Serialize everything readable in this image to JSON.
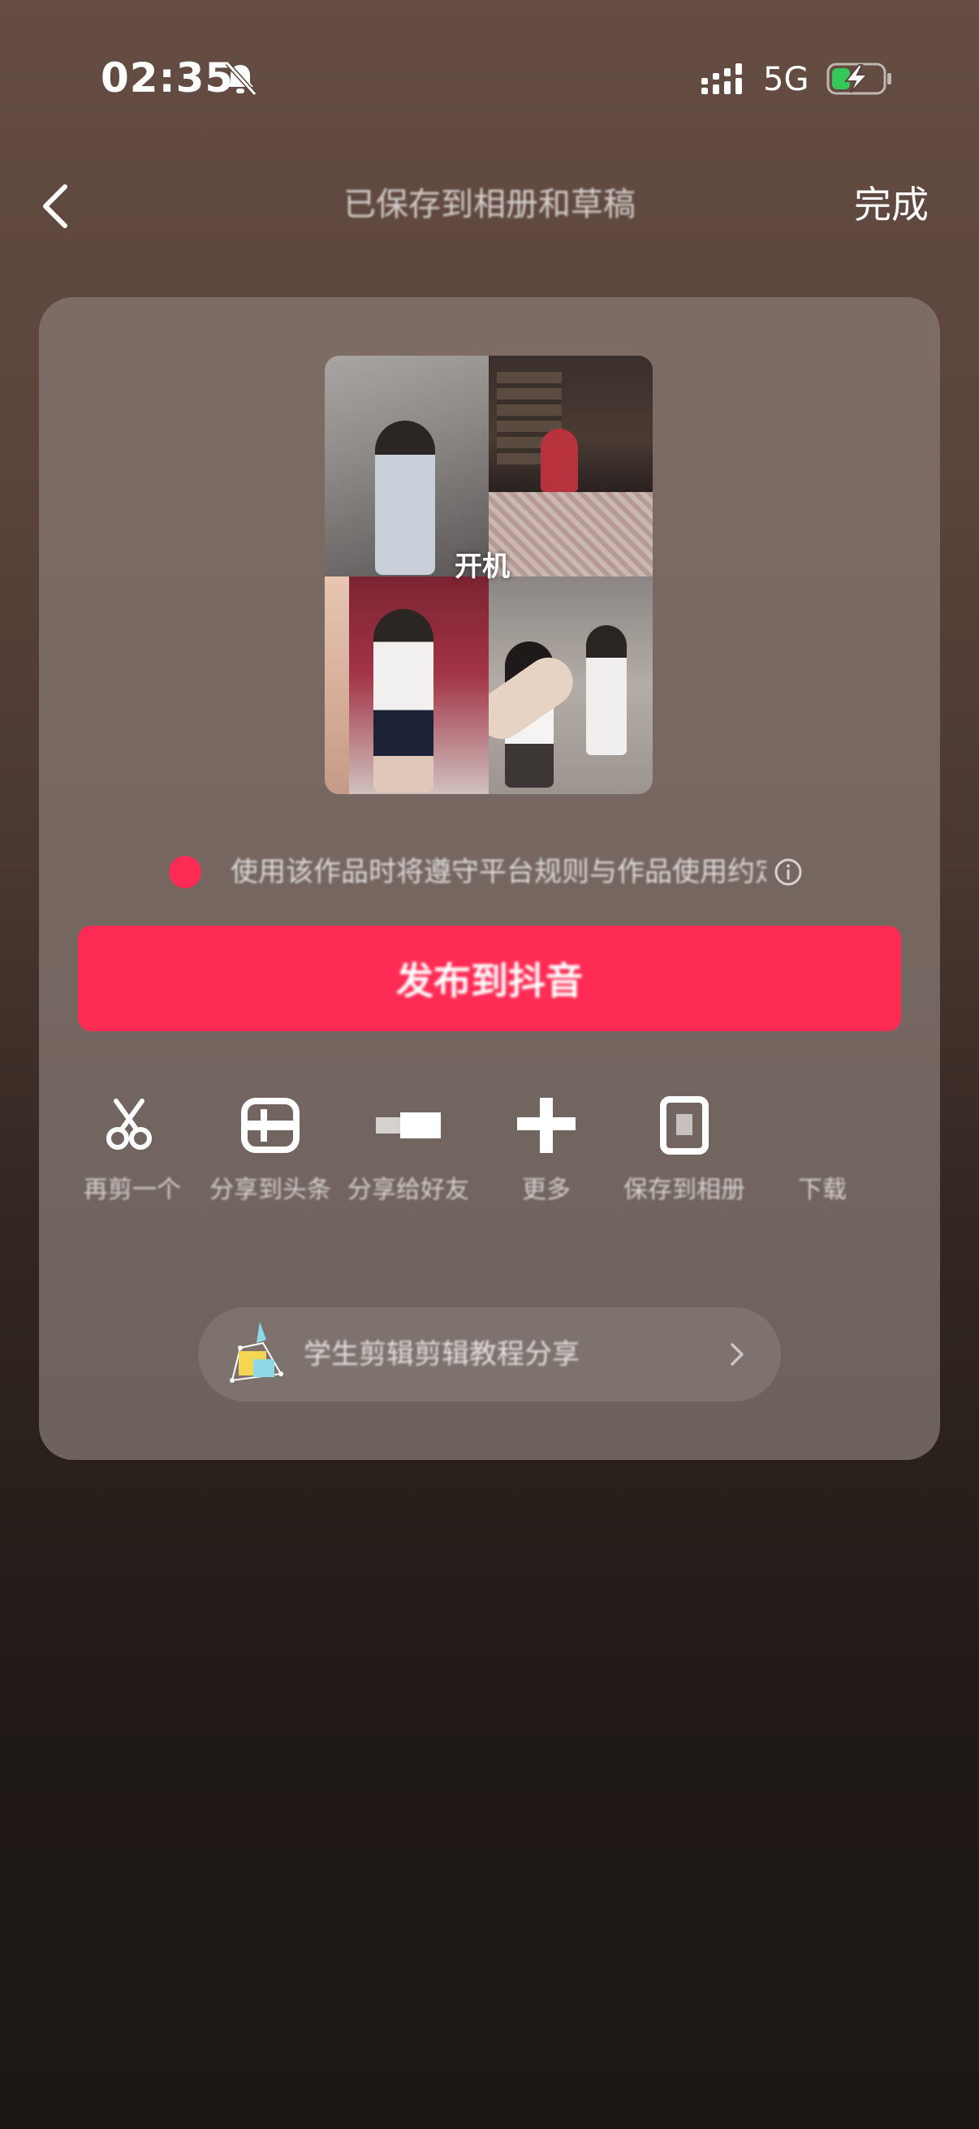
{
  "status_bar": {
    "time": "02:35",
    "network": "5G",
    "icons": [
      "bell-muted-icon",
      "signal-icon",
      "battery-charging-icon"
    ]
  },
  "nav": {
    "back_icon": "chevron-left-icon",
    "title": "已保存到相册和草稿",
    "done_label": "完成"
  },
  "preview": {
    "overlay_text": "开机"
  },
  "hint": {
    "text": "使用该作品时将遵守平台规则与作品使用约定",
    "accent_color": "#fe2c55",
    "icon": "info-circle-icon"
  },
  "primary_button": {
    "label": "发布到抖音",
    "color": "#fe2c55"
  },
  "actions": [
    {
      "label": "再剪一个",
      "icon": "scissors-icon"
    },
    {
      "label": "分享到头条",
      "icon": "frame-icon"
    },
    {
      "label": "分享给好友",
      "icon": "share-bar-icon"
    },
    {
      "label": "更多",
      "icon": "plus-icon"
    },
    {
      "label": "保存到相册",
      "icon": "save-icon"
    },
    {
      "label": "下载",
      "icon": "download-icon"
    }
  ],
  "promo": {
    "text": "学生剪辑剪辑教程分享",
    "icon": "promo-sticker-icon",
    "chevron_icon": "chevron-right-icon"
  }
}
